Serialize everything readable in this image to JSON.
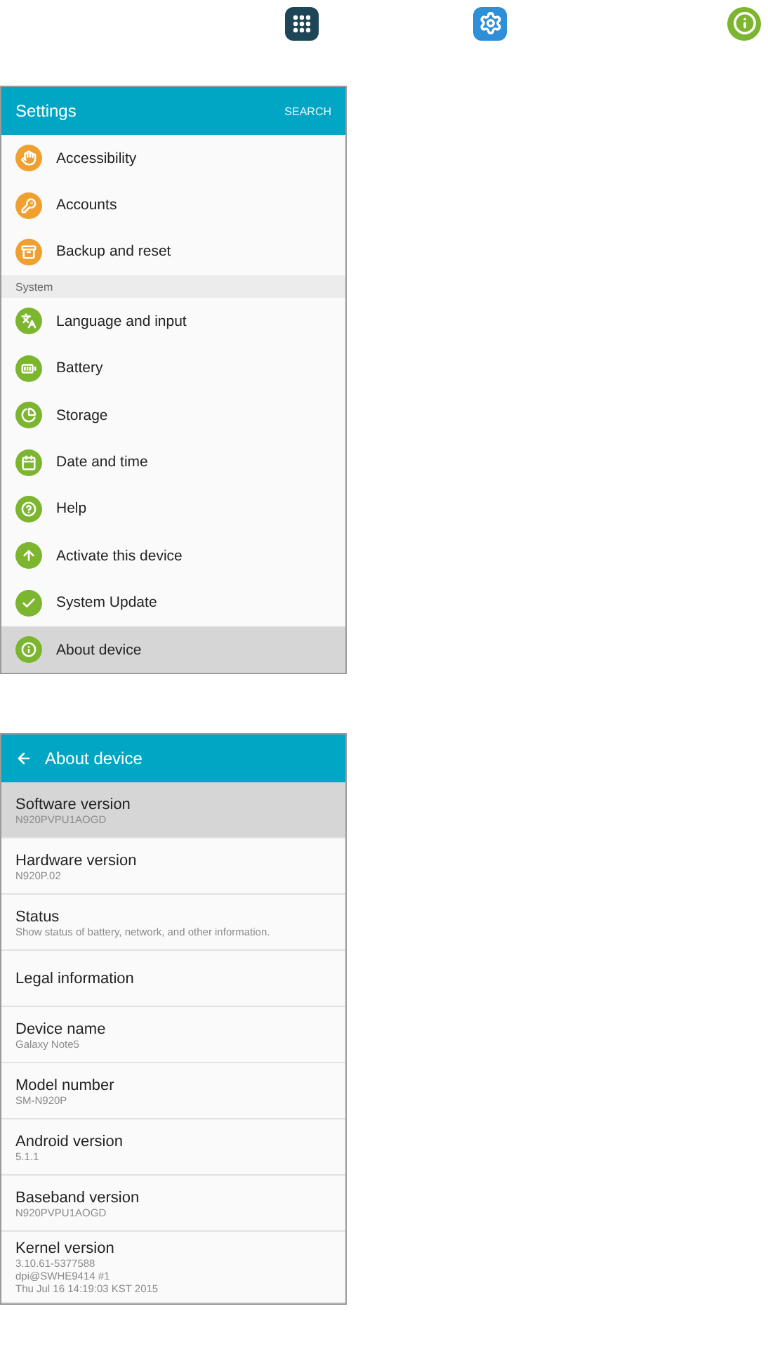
{
  "settings_screen": {
    "title": "Settings",
    "action": "SEARCH",
    "items": [
      {
        "kind": "item",
        "label": "Accessibility",
        "color": "#f0a030",
        "selected": false
      },
      {
        "kind": "item",
        "label": "Accounts",
        "color": "#f0a030",
        "selected": false
      },
      {
        "kind": "item",
        "label": "Backup and reset",
        "color": "#f0a030",
        "selected": false
      },
      {
        "kind": "section",
        "label": "System"
      },
      {
        "kind": "item",
        "label": "Language and input",
        "color": "#7cb52e",
        "selected": false
      },
      {
        "kind": "item",
        "label": "Battery",
        "color": "#7cb52e",
        "selected": false
      },
      {
        "kind": "item",
        "label": "Storage",
        "color": "#7cb52e",
        "selected": false
      },
      {
        "kind": "item",
        "label": "Date and time",
        "color": "#7cb52e",
        "selected": false
      },
      {
        "kind": "item",
        "label": "Help",
        "color": "#7cb52e",
        "selected": false
      },
      {
        "kind": "item",
        "label": "Activate this device",
        "color": "#7cb52e",
        "selected": false
      },
      {
        "kind": "item",
        "label": "System Update",
        "color": "#7cb52e",
        "selected": false
      },
      {
        "kind": "item",
        "label": "About device",
        "color": "#7cb52e",
        "selected": true
      }
    ]
  },
  "about_screen": {
    "title": "About device",
    "rows": [
      {
        "title": "Software version",
        "details": [
          "N920PVPU1AOGD"
        ],
        "selected": true
      },
      {
        "title": "Hardware version",
        "details": [
          "N920P.02"
        ],
        "selected": false
      },
      {
        "title": "Status",
        "details": [
          "Show status of battery, network, and other information."
        ],
        "selected": false
      },
      {
        "title": "Legal information",
        "details": [],
        "selected": false
      },
      {
        "title": "Device name",
        "details": [
          "Galaxy Note5"
        ],
        "selected": false
      },
      {
        "title": "Model number",
        "details": [
          "SM-N920P"
        ],
        "selected": false
      },
      {
        "title": "Android version",
        "details": [
          "5.1.1"
        ],
        "selected": false
      },
      {
        "title": "Baseband version",
        "details": [
          "N920PVPU1AOGD"
        ],
        "selected": false
      },
      {
        "title": "Kernel version",
        "details": [
          "3.10.61-5377588",
          "dpi@SWHE9414 #1",
          "Thu Jul 16 14:19:03 KST 2015"
        ],
        "selected": false
      }
    ]
  }
}
